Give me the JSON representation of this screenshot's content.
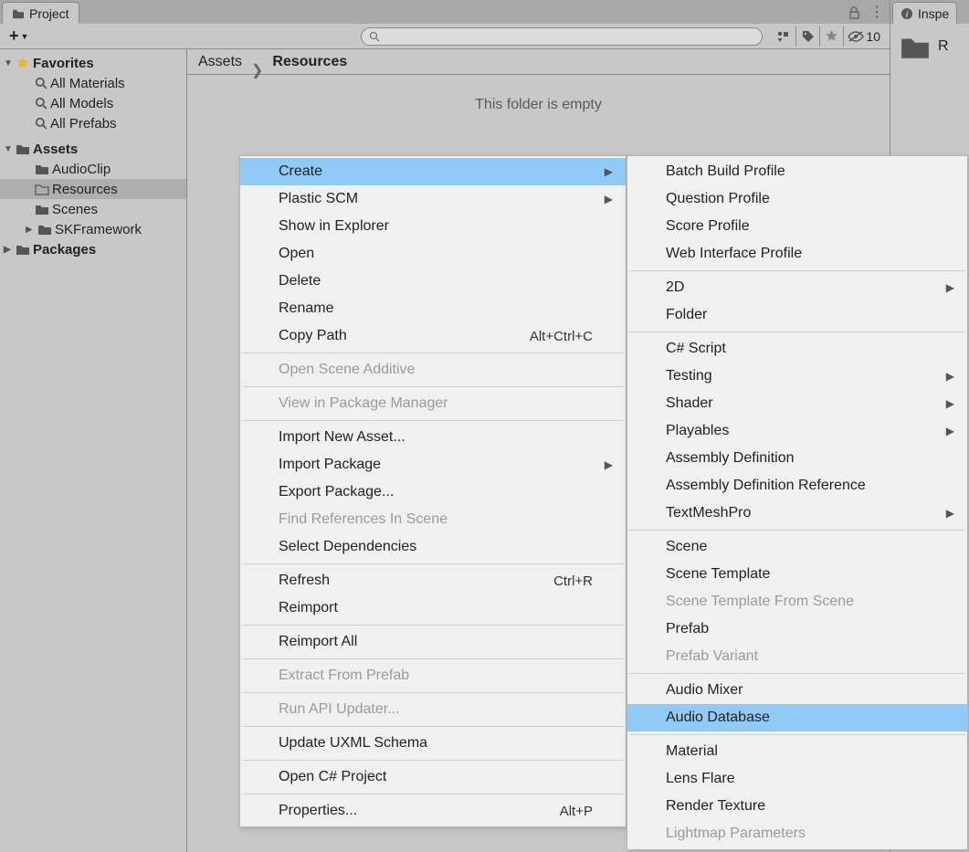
{
  "tabs": {
    "project": "Project",
    "inspector": "Inspe",
    "inspector_body": "R"
  },
  "toolbar": {
    "search_placeholder": "",
    "hidden_count": "10"
  },
  "tree": {
    "favorites": "Favorites",
    "fav_items": [
      "All Materials",
      "All Models",
      "All Prefabs"
    ],
    "assets": "Assets",
    "asset_items": [
      "AudioClip",
      "Resources",
      "Scenes",
      "SKFramework"
    ],
    "packages": "Packages"
  },
  "breadcrumb": {
    "root": "Assets",
    "current": "Resources"
  },
  "content": {
    "empty": "This folder is empty"
  },
  "context_menu": {
    "items": [
      {
        "label": "Create",
        "sub": true,
        "hl": true
      },
      {
        "label": "Plastic SCM",
        "sub": true
      },
      {
        "label": "Show in Explorer"
      },
      {
        "label": "Open"
      },
      {
        "label": "Delete"
      },
      {
        "label": "Rename"
      },
      {
        "label": "Copy Path",
        "kb": "Alt+Ctrl+C"
      },
      {
        "sep": true
      },
      {
        "label": "Open Scene Additive",
        "disabled": true
      },
      {
        "sep": true
      },
      {
        "label": "View in Package Manager",
        "disabled": true
      },
      {
        "sep": true
      },
      {
        "label": "Import New Asset..."
      },
      {
        "label": "Import Package",
        "sub": true
      },
      {
        "label": "Export Package..."
      },
      {
        "label": "Find References In Scene",
        "disabled": true
      },
      {
        "label": "Select Dependencies"
      },
      {
        "sep": true
      },
      {
        "label": "Refresh",
        "kb": "Ctrl+R"
      },
      {
        "label": "Reimport"
      },
      {
        "sep": true
      },
      {
        "label": "Reimport All"
      },
      {
        "sep": true
      },
      {
        "label": "Extract From Prefab",
        "disabled": true
      },
      {
        "sep": true
      },
      {
        "label": "Run API Updater...",
        "disabled": true
      },
      {
        "sep": true
      },
      {
        "label": "Update UXML Schema"
      },
      {
        "sep": true
      },
      {
        "label": "Open C# Project"
      },
      {
        "sep": true
      },
      {
        "label": "Properties...",
        "kb": "Alt+P"
      }
    ]
  },
  "create_menu": {
    "items": [
      {
        "label": "Batch Build Profile"
      },
      {
        "label": "Question Profile"
      },
      {
        "label": "Score Profile"
      },
      {
        "label": "Web Interface Profile"
      },
      {
        "sep": true
      },
      {
        "label": "2D",
        "sub": true
      },
      {
        "label": "Folder"
      },
      {
        "sep": true
      },
      {
        "label": "C# Script"
      },
      {
        "label": "Testing",
        "sub": true
      },
      {
        "label": "Shader",
        "sub": true
      },
      {
        "label": "Playables",
        "sub": true
      },
      {
        "label": "Assembly Definition"
      },
      {
        "label": "Assembly Definition Reference"
      },
      {
        "label": "TextMeshPro",
        "sub": true
      },
      {
        "sep": true
      },
      {
        "label": "Scene"
      },
      {
        "label": "Scene Template"
      },
      {
        "label": "Scene Template From Scene",
        "disabled": true
      },
      {
        "label": "Prefab"
      },
      {
        "label": "Prefab Variant",
        "disabled": true
      },
      {
        "sep": true
      },
      {
        "label": "Audio Mixer"
      },
      {
        "label": "Audio Database",
        "hl": true
      },
      {
        "sep": true
      },
      {
        "label": "Material"
      },
      {
        "label": "Lens Flare"
      },
      {
        "label": "Render Texture"
      },
      {
        "label": "Lightmap Parameters",
        "disabled": true
      }
    ]
  }
}
